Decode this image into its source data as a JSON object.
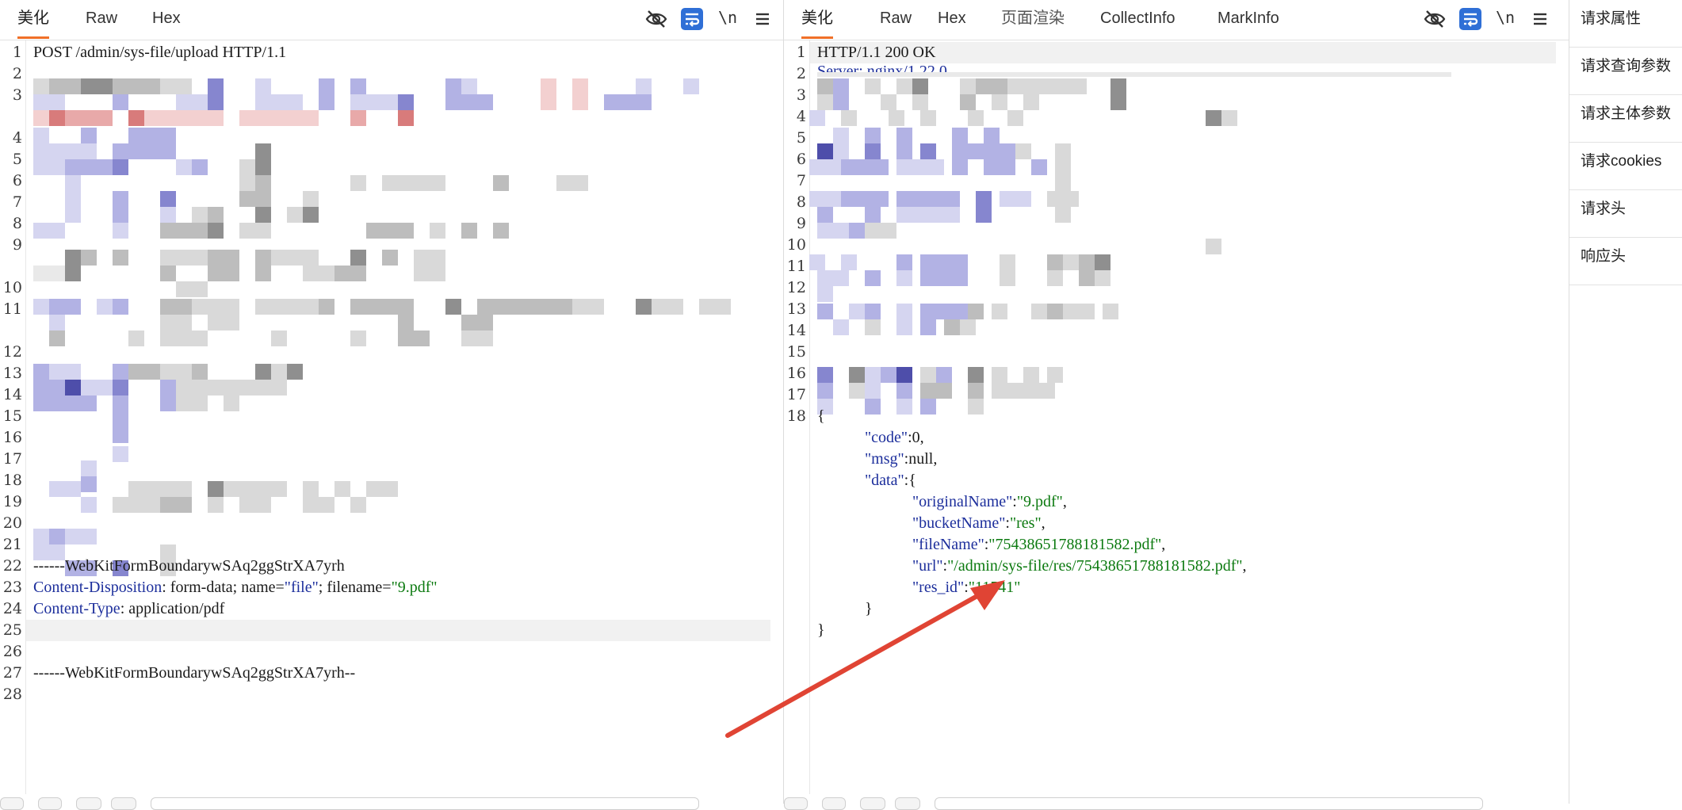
{
  "left": {
    "tabs": [
      "美化",
      "Raw",
      "Hex"
    ],
    "active_tab": 0,
    "icons": [
      "eye-off-icon",
      "wrap-icon",
      "newline-icon",
      "menu-icon"
    ],
    "newline_label": "\\n",
    "line_numbers": [
      "1",
      "2",
      "3",
      "4",
      "5",
      "6",
      "7",
      "8",
      "9",
      "10",
      "11",
      "12",
      "13",
      "14",
      "15",
      "16",
      "17",
      "18",
      "19",
      "20",
      "21",
      "22",
      "23",
      "24",
      "25",
      "26",
      "27",
      "28"
    ],
    "request_line": "POST /admin/sys-file/upload HTTP/1.1",
    "boundary": "------WebKitFormBoundarywSAq2ggStrXA7yrh",
    "cd_header": "Content-Disposition",
    "cd_value_1": ": form-data; name=",
    "cd_name_val": "\"file\"",
    "cd_value_2": "; filename=",
    "cd_filename_val": "\"9.pdf\"",
    "ct_header": "Content-Type",
    "ct_value": ": application/pdf",
    "boundary_end": "------WebKitFormBoundarywSAq2ggStrXA7yrh--"
  },
  "right": {
    "tabs": [
      "美化",
      "Raw",
      "Hex",
      "页面渲染",
      "CollectInfo",
      "MarkInfo"
    ],
    "active_tab": 0,
    "icons": [
      "eye-off-icon",
      "wrap-icon",
      "newline-icon",
      "menu-icon"
    ],
    "newline_label": "\\n",
    "line_numbers": [
      "1",
      "2",
      "3",
      "4",
      "5",
      "6",
      "7",
      "8",
      "9",
      "10",
      "11",
      "12",
      "13",
      "14",
      "15",
      "16",
      "17",
      "18"
    ],
    "status_line": "HTTP/1.1 200 OK",
    "server_partial": "Server: nginx/1.22.0",
    "json": {
      "open": "{",
      "code_key": "\"code\"",
      "code_val": ":0,",
      "msg_key": "\"msg\"",
      "msg_val": ":null,",
      "data_key": "\"data\"",
      "data_open": ":{",
      "originalName_key": "\"originalName\"",
      "originalName_val": "\"9.pdf\"",
      "bucketName_key": "\"bucketName\"",
      "bucketName_val": "\"res\"",
      "fileName_key": "\"fileName\"",
      "fileName_val": "\"75438651788181582.pdf\"",
      "url_key": "\"url\"",
      "url_val": "\"/admin/sys-file/res/75438651788181582.pdf\"",
      "res_id_key": "\"res_id\"",
      "res_id_val": "\"11541\"",
      "inner_close": "}",
      "close": "}",
      "colon": ":",
      "comma": ","
    }
  },
  "side": {
    "items": [
      "请求属性",
      "请求查询参数",
      "请求主体参数",
      "请求cookies",
      "请求头",
      "响应头"
    ]
  },
  "colors": {
    "accent_tab": "#f07028",
    "icon_active": "#2f6fd6",
    "arrow": "#e04434"
  }
}
